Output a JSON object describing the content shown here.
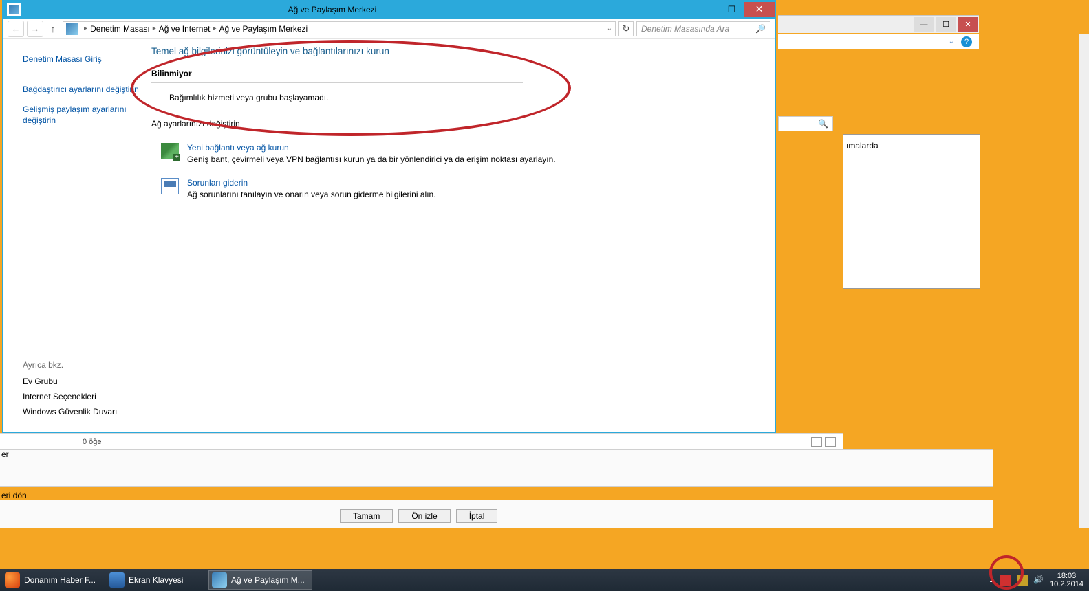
{
  "bg": {
    "malarda": "ımalarda",
    "er": "er",
    "eridon": "eri dön",
    "tamam": "Tamam",
    "onizle": "Ön izle",
    "iptal": "İptal",
    "zero_items": "0 öğe"
  },
  "window": {
    "title": "Ağ ve Paylaşım Merkezi",
    "breadcrumb": {
      "c1": "Denetim Masası",
      "c2": "Ağ ve Internet",
      "c3": "Ağ ve Paylaşım Merkezi"
    },
    "search_placeholder": "Denetim Masasında Ara"
  },
  "sidebar": {
    "home": "Denetim Masası Giriş",
    "adapter": "Bağdaştırıcı ayarlarını değiştirin",
    "advshare": "Gelişmiş paylaşım ayarlarını değiştirin",
    "footer_hdr": "Ayrıca bkz.",
    "homegroup": "Ev Grubu",
    "inetopt": "Internet Seçenekleri",
    "firewall": "Windows Güvenlik Duvarı"
  },
  "content": {
    "heading": "Temel ağ bilgilerinizi görüntüleyin ve bağlantılarınızı kurun",
    "unknown": "Bilinmiyor",
    "dep_err": "Bağımlılık hizmeti veya grubu başlayamadı.",
    "change_hdr": "Ağ ayarlarınızı değiştirin",
    "a1_title": "Yeni bağlantı veya ağ kurun",
    "a1_desc": "Geniş bant, çevirmeli veya VPN bağlantısı kurun ya da bir yönlendirici ya da erişim noktası ayarlayın.",
    "a2_title": "Sorunları giderin",
    "a2_desc": "Ağ sorunlarını tanılayın ve onarın veya sorun giderme bilgilerini alın."
  },
  "taskbar": {
    "t1": "Donanım Haber F...",
    "t2": "Ekran Klavyesi",
    "t3": "Ağ ve Paylaşım M...",
    "time": "18:03",
    "date": "10.2.2014"
  }
}
